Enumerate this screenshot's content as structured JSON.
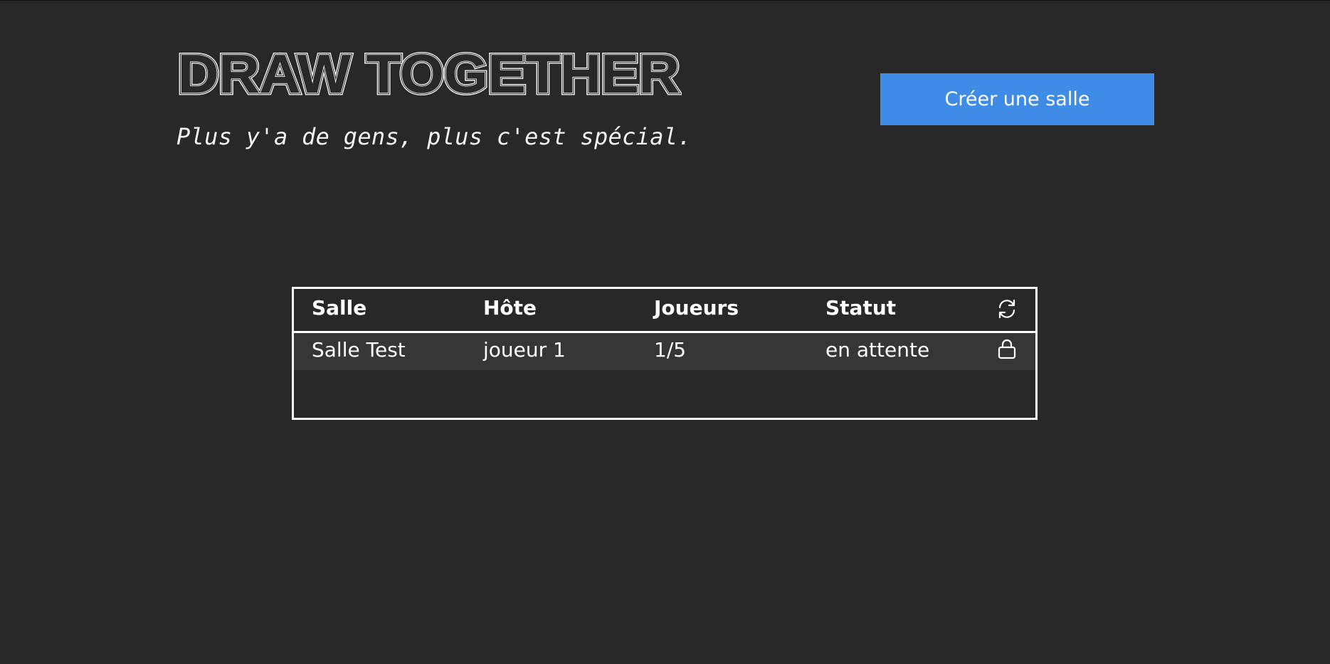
{
  "app": {
    "title": "DRAW TOGETHER",
    "tagline": "Plus y'a de gens, plus c'est spécial."
  },
  "actions": {
    "create_room_label": "Créer une salle"
  },
  "rooms_table": {
    "columns": [
      "Salle",
      "Hôte",
      "Joueurs",
      "Statut"
    ],
    "refresh_icon": "refresh-icon",
    "rows": [
      {
        "room": "Salle Test",
        "host": "joueur 1",
        "players": "1/5",
        "status": "en attente",
        "icon": "lock-icon"
      }
    ]
  },
  "colors": {
    "background": "#282828",
    "accent": "#3f8ce6",
    "row_highlight": "#363636",
    "text": "#ffffff"
  }
}
